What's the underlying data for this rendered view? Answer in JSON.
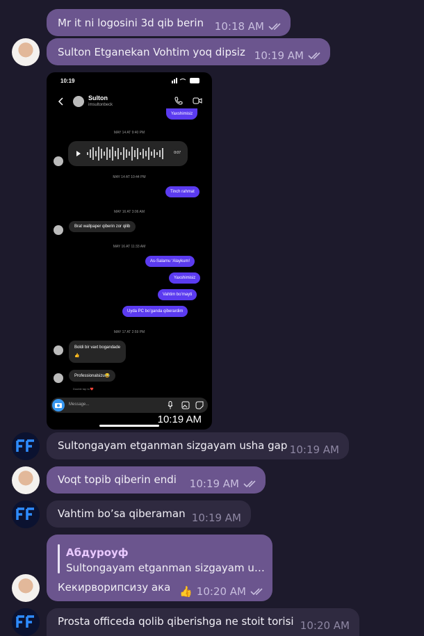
{
  "messages": [
    {
      "text": "Mr it ni logosini 3d qib berin",
      "time": "10:18 AM"
    },
    {
      "text": "Sulton Etganekan Vohtim yoq dipsiz",
      "time": "10:19 AM"
    },
    {
      "image_time": "10:19 AM"
    },
    {
      "text": "Sultongayam etganman sizgayam usha gap",
      "time": "10:19 AM"
    },
    {
      "text": "Voqt topib qiberin endi",
      "time": "10:19 AM"
    },
    {
      "text": "Vahtim bo’sa qiberaman",
      "time": "10:19 AM"
    },
    {
      "reply_name": "Абдуроуф",
      "reply_text": "Sultongayam etganman sizgayam u…",
      "text": "Кекирворипсизу ака",
      "reaction": "👍",
      "time": "10:20 AM"
    },
    {
      "text": "Prosta officeda qolib qiberishga ne stoit torisi",
      "time": "10:20 AM"
    }
  ],
  "shot": {
    "status_time": "10:19",
    "contact_name": "Sulton",
    "contact_user": "imsultonbeck",
    "top_msg": "Yaxshimisiz",
    "dates": [
      "MAY 14 AT 9:40 PM",
      "MAY 14 AT 10:44 PM",
      "MAY 16 AT 3:06 AM",
      "MAY 16 AT 11:33 AM",
      "MAY 17 AT 2:59 PM"
    ],
    "voice_duration": "0:07",
    "tinch": "Tinch rahmat",
    "brat": "Brat wallpaper qiberin zor qilib",
    "out_msgs": [
      "As-Salamu ‘Alaykum!",
      "Yaxshimisiz",
      "Vahtim bo’mayti",
      "Uyda PC bo’ganda qiberardim"
    ],
    "boldi": "Boldi bir vaxt bogandade",
    "boldi_emoji": "👍",
    "prof": "Professionalsizu😂",
    "hint": "Double tap to ❤️",
    "message_placeholder": "Message..."
  }
}
